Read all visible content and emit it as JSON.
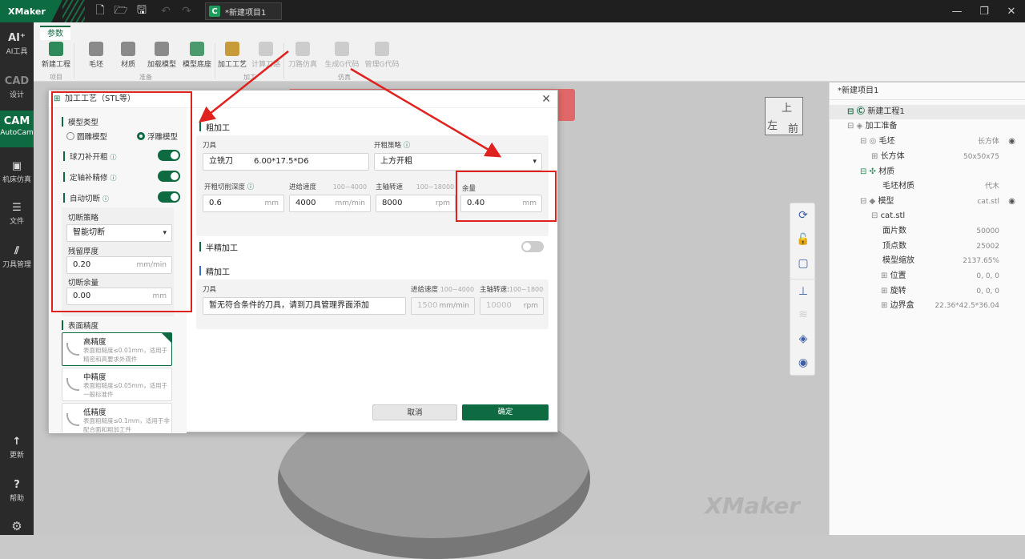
{
  "titlebar": {
    "logo": "XMaker",
    "doc_tab": "*新建项目1",
    "doc_tab_letter": "C"
  },
  "leftbar": {
    "items": [
      {
        "icon": "AI⁺",
        "label": "AI工具"
      },
      {
        "icon": "CAD",
        "label": "设计"
      },
      {
        "icon": "CAM",
        "label": "AutoCam"
      },
      {
        "icon": "▣",
        "label": "机床仿真"
      },
      {
        "icon": "☰",
        "label": "文件"
      },
      {
        "icon": "⫽",
        "label": "刀具管理"
      },
      {
        "icon": "↑",
        "label": "更新"
      },
      {
        "icon": "?",
        "label": "帮助"
      }
    ]
  },
  "ribbon": {
    "tab": "参数",
    "buttons": [
      "新建工程",
      "毛坯",
      "材质",
      "加载模型",
      "模型底座",
      "加工工艺",
      "计算刀路",
      "刀路仿真",
      "生成G代码",
      "管理G代码"
    ],
    "groups": [
      "项目",
      "准备",
      "加工",
      "仿真"
    ]
  },
  "right_panel": {
    "title": "*新建项目1",
    "tree": [
      {
        "label": "新建工程1",
        "value": ""
      },
      {
        "label": "加工准备",
        "value": ""
      },
      {
        "label": "毛坯",
        "value": "长方体"
      },
      {
        "label": "长方体",
        "value": "50x50x75"
      },
      {
        "label": "材质",
        "value": ""
      },
      {
        "label": "毛坯材质",
        "value": "代木"
      },
      {
        "label": "模型",
        "value": "cat.stl"
      },
      {
        "label": "cat.stl",
        "value": ""
      },
      {
        "label": "面片数",
        "value": "50000"
      },
      {
        "label": "顶点数",
        "value": "25002"
      },
      {
        "label": "模型缩放",
        "value": "2137.65%"
      },
      {
        "label": "位置",
        "value": "0, 0, 0"
      },
      {
        "label": "旋转",
        "value": "0, 0, 0"
      },
      {
        "label": "边界盒",
        "value": "22.36*42.5*36.04"
      }
    ]
  },
  "viewport": {
    "watermark": "XMaker",
    "cube_top": "上",
    "cube_left": "左",
    "cube_front": "前"
  },
  "dialog": {
    "title": "加工工艺（STL等）",
    "model_type_label": "模型类型",
    "radio_round": "圆雕模型",
    "radio_relief": "浮雕模型",
    "ball_rough": "球刀补开粗",
    "fixed_axis": "定轴补精修",
    "auto_cut": "自动切断",
    "cut_strategy_label": "切断策略",
    "cut_strategy_value": "智能切断",
    "residual_label": "残留厚度",
    "residual_value": "0.20",
    "residual_unit": "mm/min",
    "cut_allow_label": "切断余量",
    "cut_allow_value": "0.00",
    "cut_allow_unit": "mm",
    "surface_label": "表面精度",
    "precision": [
      {
        "title": "高精度",
        "desc": "表面粗糙度≤0.01mm，适用于精密和高要求外观件"
      },
      {
        "title": "中精度",
        "desc": "表面粗糙度≤0.05mm，适用于一般标准件"
      },
      {
        "title": "低精度",
        "desc": "表面粗糙度≤0.1mm，适用于非配合面和粗加工件"
      }
    ],
    "rough": {
      "section": "粗加工",
      "tool_label": "刀具",
      "tool_value": "立铣刀",
      "tool_spec": "6.00*17.5*D6",
      "strategy_label": "开粗策略",
      "strategy_value": "上方开粗",
      "depth_label": "开粗切削深度",
      "depth_value": "0.6",
      "depth_unit": "mm",
      "feed_label": "进给速度",
      "feed_hint": "100~4000",
      "feed_value": "4000",
      "feed_unit": "mm/min",
      "spindle_label": "主轴转速",
      "spindle_hint": "100~18000",
      "spindle_value": "8000",
      "spindle_unit": "rpm",
      "allow_label": "余量",
      "allow_value": "0.40",
      "allow_unit": "mm"
    },
    "semi": {
      "section": "半精加工"
    },
    "finish": {
      "section": "精加工",
      "tool_label": "刀具",
      "tool_value": "暂无符合条件的刀具，请到刀具管理界面添加",
      "feed_label": "进给速度",
      "feed_hint": "100~4000",
      "feed_value": "1500",
      "feed_unit": "mm/min",
      "spindle_label": "主轴转速:",
      "spindle_hint": "100~18000",
      "spindle_value": "10000",
      "spindle_unit": "rpm"
    },
    "cancel": "取消",
    "ok": "确定"
  },
  "colors": {
    "accent": "#0e6a41",
    "highlight": "#e0221f"
  }
}
